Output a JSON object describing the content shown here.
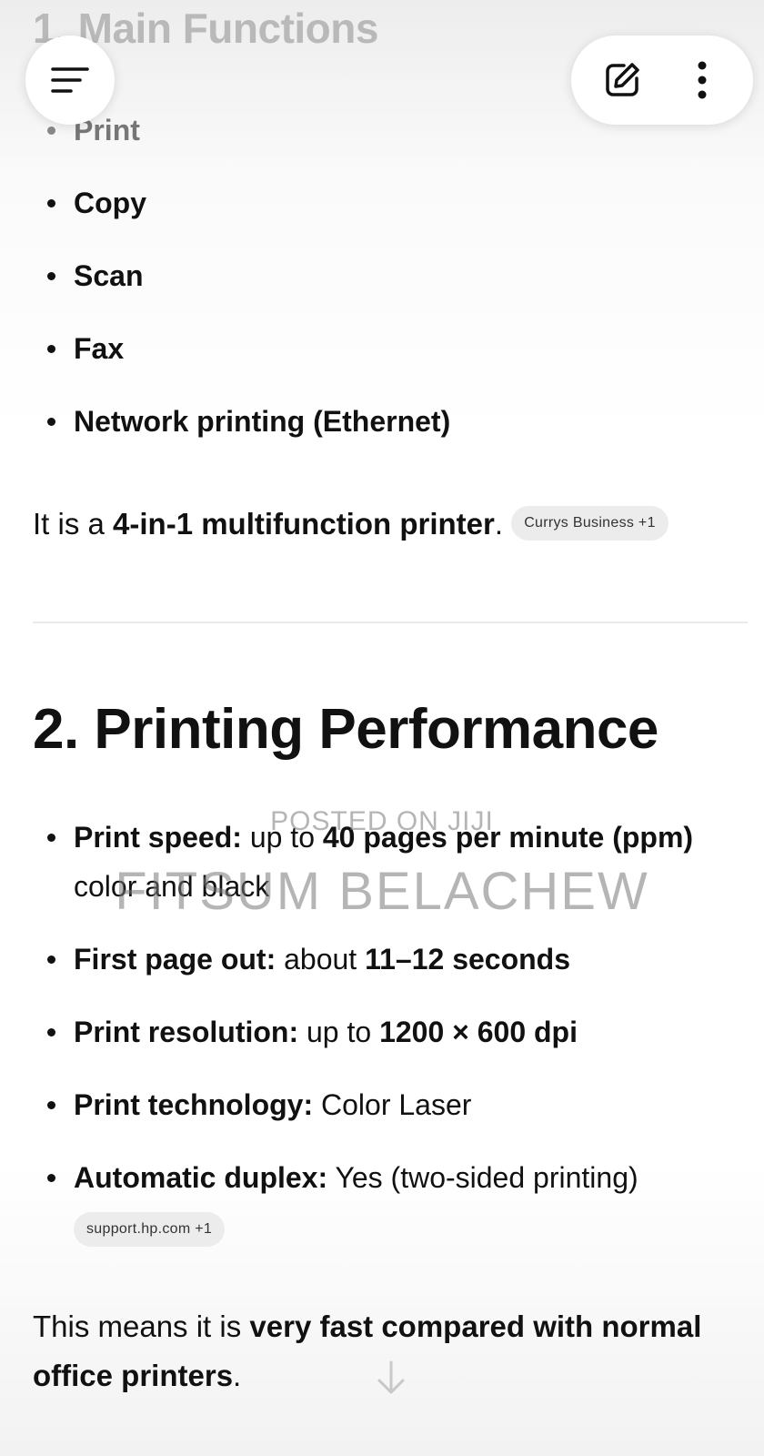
{
  "section1": {
    "heading": "1. Main Functions",
    "functions": [
      "Print",
      "Copy",
      "Scan",
      "Fax",
      "Network printing (Ethernet)"
    ],
    "summary": {
      "prefix": "It is a ",
      "bold": "4-in-1 multifunction printer",
      "suffix": ".",
      "source_chip": "Currys Business +1"
    }
  },
  "section2": {
    "heading": "2. Printing Performance",
    "items": [
      {
        "label": "Print speed:",
        "parts": [
          " up to ",
          "40 pages per minute (ppm)",
          " color and black"
        ]
      },
      {
        "label": "First page out:",
        "parts": [
          " about ",
          "11–12 seconds",
          ""
        ]
      },
      {
        "label": "Print resolution:",
        "parts": [
          " up to ",
          "1200 × 600 dpi",
          ""
        ]
      },
      {
        "label": "Print technology:",
        "parts": [
          " Color Laser",
          "",
          ""
        ]
      },
      {
        "label": "Automatic duplex:",
        "parts": [
          " Yes (two-sided printing)",
          "",
          ""
        ],
        "source_chip": "support.hp.com +1"
      }
    ],
    "conclusion": {
      "prefix": "This means it is ",
      "bold": "very fast compared with normal office printers",
      "suffix": "."
    }
  },
  "watermark": {
    "line1": "POSTED ON JIJI",
    "line2": "FITSUM BELACHEW"
  },
  "icons": {
    "menu": "menu-icon",
    "edit": "edit-icon",
    "more": "more-vertical-icon",
    "scroll_down": "arrow-down-icon"
  }
}
